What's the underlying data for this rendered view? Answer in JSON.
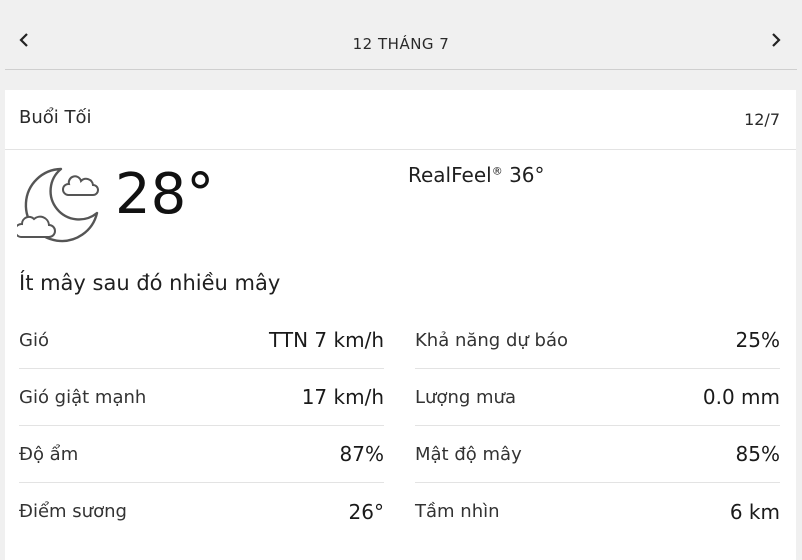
{
  "nav": {
    "prev_icon": "chevron-left-icon",
    "next_icon": "chevron-right-icon",
    "date_label": "12 THÁNG 7"
  },
  "card": {
    "period": "Buổi Tối",
    "short_date": "12/7",
    "icon": "cloudy-night-icon",
    "temperature": "28°",
    "realfeel_label": "RealFeel",
    "realfeel_mark": "®",
    "realfeel_value": "36°",
    "phrase": "Ít mây sau đó nhiều mây",
    "left_details": [
      {
        "label": "Gió",
        "value": "TTN 7 km/h"
      },
      {
        "label": "Gió giật mạnh",
        "value": "17 km/h"
      },
      {
        "label": "Độ ẩm",
        "value": "87%"
      },
      {
        "label": "Điểm sương",
        "value": "26°"
      }
    ],
    "right_details": [
      {
        "label": "Khả năng dự báo",
        "value": "25%"
      },
      {
        "label": "Lượng mưa",
        "value": "0.0 mm"
      },
      {
        "label": "Mật độ mây",
        "value": "85%"
      },
      {
        "label": "Tầm nhìn",
        "value": "6 km"
      }
    ]
  },
  "colors": {
    "page_background": "#f0f0f0",
    "card_background": "#ffffff",
    "divider": "#e3e3e3",
    "text": "#1f1f1f"
  }
}
